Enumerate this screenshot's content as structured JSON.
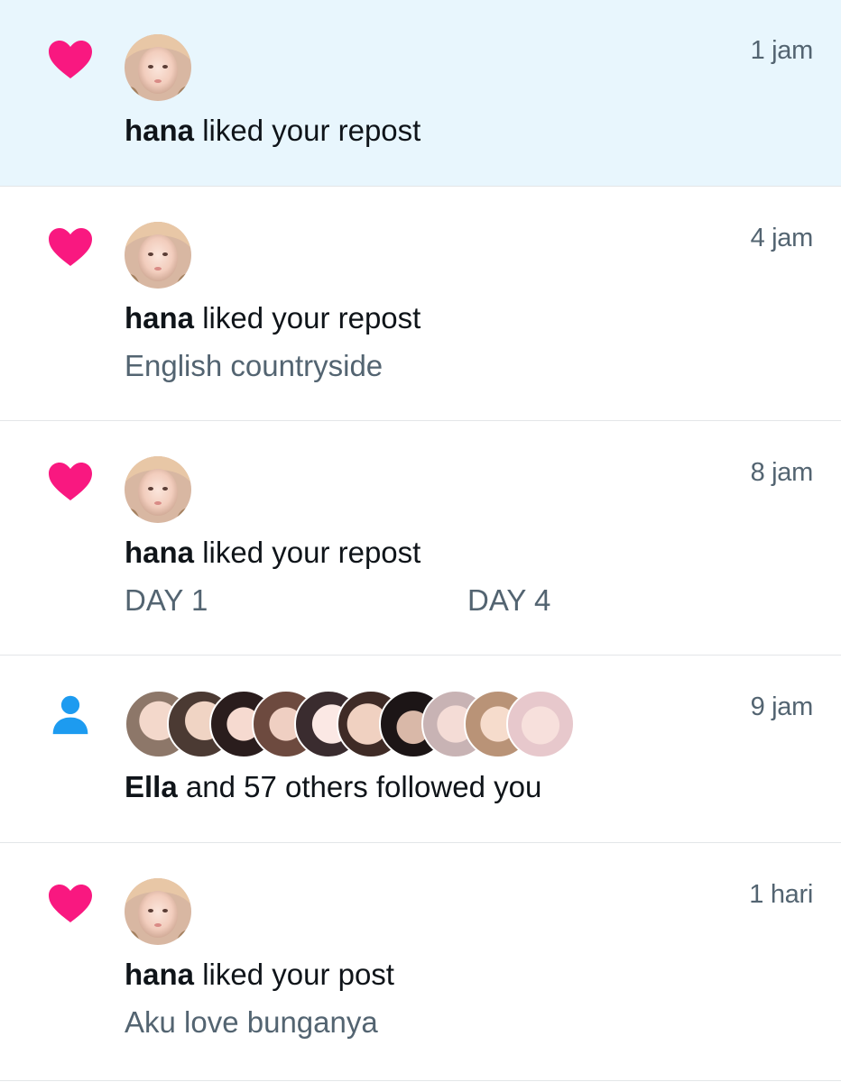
{
  "colors": {
    "like_heart": "#f91880",
    "follow_icon": "#1d9bf0",
    "unread_bg": "#e8f6fd",
    "muted_text": "#536471",
    "primary_text": "#0f1419"
  },
  "notifications": [
    {
      "type_icon": "heart-icon",
      "time": "1 jam",
      "actor": "hana",
      "action": " liked your repost",
      "unread": true
    },
    {
      "type_icon": "heart-icon",
      "time": "4 jam",
      "actor": "hana",
      "action": " liked your repost",
      "preview": "English countryside"
    },
    {
      "type_icon": "heart-icon",
      "time": "8 jam",
      "actor": "hana",
      "action": " liked your repost",
      "preview_parts": [
        "DAY 1",
        "DAY 4"
      ]
    },
    {
      "type_icon": "person-icon",
      "time": "9 jam",
      "actor": "Ella",
      "action": " and 57 others followed you",
      "avatar_count": 10
    },
    {
      "type_icon": "heart-icon",
      "time": "1 hari",
      "actor": "hana",
      "action": " liked your post",
      "preview": "Aku love bunganya"
    }
  ]
}
